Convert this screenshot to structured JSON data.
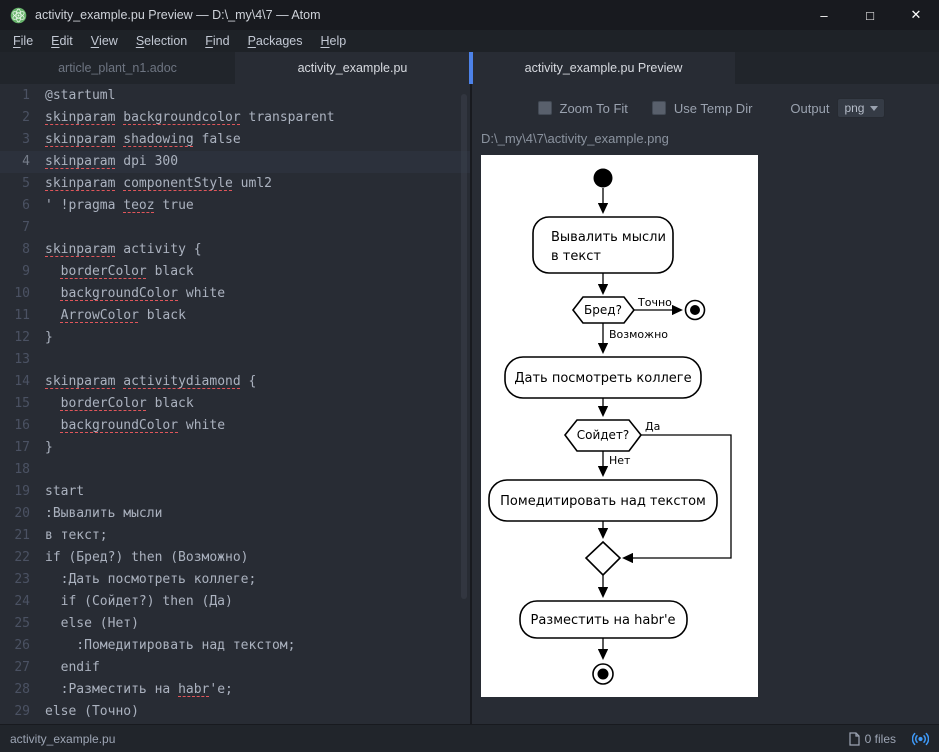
{
  "window": {
    "title": "activity_example.pu Preview — D:\\_my\\4\\7 — Atom",
    "glyphs": {
      "minimize": "–",
      "maximize": "□",
      "close": "✕"
    }
  },
  "menu": {
    "items": [
      {
        "key": "F",
        "rest": "ile"
      },
      {
        "key": "E",
        "rest": "dit"
      },
      {
        "key": "V",
        "rest": "iew"
      },
      {
        "key": "S",
        "rest": "election"
      },
      {
        "key": "F",
        "rest": "ind"
      },
      {
        "key": "P",
        "rest": "ackages"
      },
      {
        "key": "H",
        "rest": "elp"
      }
    ]
  },
  "tabs": {
    "left": [
      {
        "label": "article_plant_n1.adoc"
      },
      {
        "label": "activity_example.pu"
      }
    ],
    "right": [
      {
        "label": "activity_example.pu Preview"
      }
    ]
  },
  "editor": {
    "active_line": 4,
    "lines": [
      [
        {
          "t": "@startuml"
        }
      ],
      [
        {
          "t": "skinparam",
          "u": true
        },
        {
          "t": " "
        },
        {
          "t": "backgroundcolor",
          "u": true
        },
        {
          "t": " transparent"
        }
      ],
      [
        {
          "t": "skinparam",
          "u": true
        },
        {
          "t": " "
        },
        {
          "t": "shadowing",
          "u": true
        },
        {
          "t": " false"
        }
      ],
      [
        {
          "t": "skinparam",
          "u": true
        },
        {
          "t": " dpi 300"
        }
      ],
      [
        {
          "t": "skinparam",
          "u": true
        },
        {
          "t": " "
        },
        {
          "t": "componentStyle",
          "u": true
        },
        {
          "t": " uml2"
        }
      ],
      [
        {
          "t": "' !pragma "
        },
        {
          "t": "teoz",
          "u": true
        },
        {
          "t": " true"
        }
      ],
      [
        {
          "t": ""
        }
      ],
      [
        {
          "t": "skinparam",
          "u": true
        },
        {
          "t": " activity {"
        }
      ],
      [
        {
          "t": "  "
        },
        {
          "t": "borderColor",
          "u": true
        },
        {
          "t": " black"
        }
      ],
      [
        {
          "t": "  "
        },
        {
          "t": "backgroundColor",
          "u": true
        },
        {
          "t": " white"
        }
      ],
      [
        {
          "t": "  "
        },
        {
          "t": "ArrowColor",
          "u": true
        },
        {
          "t": " black"
        }
      ],
      [
        {
          "t": "}"
        }
      ],
      [
        {
          "t": ""
        }
      ],
      [
        {
          "t": "skinparam",
          "u": true
        },
        {
          "t": " "
        },
        {
          "t": "activitydiamond",
          "u": true
        },
        {
          "t": " {"
        }
      ],
      [
        {
          "t": "  "
        },
        {
          "t": "borderColor",
          "u": true
        },
        {
          "t": " black"
        }
      ],
      [
        {
          "t": "  "
        },
        {
          "t": "backgroundColor",
          "u": true
        },
        {
          "t": " white"
        }
      ],
      [
        {
          "t": "}"
        }
      ],
      [
        {
          "t": ""
        }
      ],
      [
        {
          "t": "start"
        }
      ],
      [
        {
          "t": ":Вывалить мысли"
        }
      ],
      [
        {
          "t": "в текст;"
        }
      ],
      [
        {
          "t": "if (Бред?) then (Возможно)"
        }
      ],
      [
        {
          "t": "  :Дать посмотреть коллеге;"
        }
      ],
      [
        {
          "t": "  if (Сойдет?) then (Да)"
        }
      ],
      [
        {
          "t": "  else (Нет)"
        }
      ],
      [
        {
          "t": "    :Помедитировать над текстом;"
        }
      ],
      [
        {
          "t": "  endif"
        }
      ],
      [
        {
          "t": "  :Разместить на "
        },
        {
          "t": "habr",
          "u": true
        },
        {
          "t": "'е;"
        }
      ],
      [
        {
          "t": "else (Точно)"
        }
      ]
    ]
  },
  "preview": {
    "controls": {
      "zoom": "Zoom To Fit",
      "temp": "Use Temp Dir",
      "output_label": "Output",
      "format": "png"
    },
    "path": "D:\\_my\\4\\7\\activity_example.png",
    "diagram": {
      "box1_line1": "Вывалить мысли",
      "box1_line2": "в текст",
      "cond1": "Бред?",
      "cond1_true": "Точно",
      "cond1_false": "Возможно",
      "box2": "Дать посмотреть коллеге",
      "cond2": "Сойдет?",
      "cond2_true": "Да",
      "cond2_false": "Нет",
      "box3": "Помедитировать над текстом",
      "box4": "Разместить на habr'е"
    }
  },
  "status": {
    "file": "activity_example.pu",
    "files_label": "0 files"
  }
}
